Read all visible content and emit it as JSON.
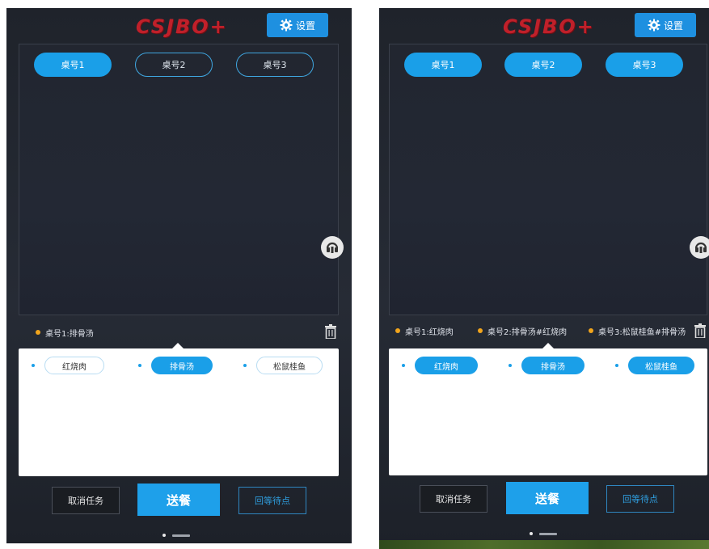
{
  "header": {
    "logo": "CSJBO+",
    "settings_label": "设置"
  },
  "left": {
    "tables": [
      {
        "label": "桌号1",
        "state": "selected"
      },
      {
        "label": "桌号2",
        "state": "unselected"
      },
      {
        "label": "桌号3",
        "state": "unselected"
      }
    ],
    "status": [
      "桌号1:排骨汤"
    ],
    "dishes": [
      {
        "label": "红烧肉",
        "state": "unselected"
      },
      {
        "label": "排骨汤",
        "state": "selected"
      },
      {
        "label": "松鼠桂鱼",
        "state": "unselected"
      }
    ],
    "actions": {
      "cancel": "取消任务",
      "send": "送餐",
      "return": "回等待点"
    }
  },
  "right": {
    "tables": [
      {
        "label": "桌号1",
        "state": "selected"
      },
      {
        "label": "桌号2",
        "state": "selected"
      },
      {
        "label": "桌号3",
        "state": "selected"
      }
    ],
    "status": [
      "桌号1:红烧肉",
      "桌号2:排骨汤#红烧肉",
      "桌号3:松鼠桂鱼#排骨汤"
    ],
    "dishes": [
      {
        "label": "红烧肉",
        "state": "selected"
      },
      {
        "label": "排骨汤",
        "state": "selected"
      },
      {
        "label": "松鼠桂鱼",
        "state": "selected"
      }
    ],
    "actions": {
      "cancel": "取消任务",
      "send": "送餐",
      "return": "回等待点"
    }
  },
  "icons": {
    "settings": "gear-icon",
    "assistant": "headset-icon",
    "delete": "trash-icon"
  },
  "colors": {
    "accent": "#1a9fe8",
    "logo": "#c0202a",
    "status_dot": "#f2a51c",
    "background": "#232834"
  }
}
